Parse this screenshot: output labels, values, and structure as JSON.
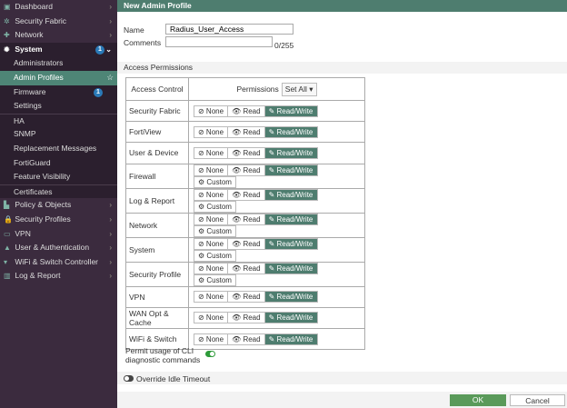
{
  "sidebar": {
    "top": [
      {
        "label": "Dashboard",
        "icon": "dashboard-icon"
      },
      {
        "label": "Security Fabric",
        "icon": "fabric-icon"
      },
      {
        "label": "Network",
        "icon": "network-icon"
      }
    ],
    "system": {
      "label": "System",
      "badge": "1"
    },
    "sub": [
      {
        "label": "Administrators"
      },
      {
        "label": "Admin Profiles",
        "active": true
      },
      {
        "label": "Firmware",
        "badge": "1"
      },
      {
        "label": "Settings"
      },
      {
        "label": "HA"
      },
      {
        "label": "SNMP"
      },
      {
        "label": "Replacement Messages"
      },
      {
        "label": "FortiGuard"
      },
      {
        "label": "Feature Visibility"
      },
      {
        "label": "Certificates"
      }
    ],
    "bottom": [
      {
        "label": "Policy & Objects"
      },
      {
        "label": "Security Profiles"
      },
      {
        "label": "VPN"
      },
      {
        "label": "User & Authentication"
      },
      {
        "label": "WiFi & Switch Controller"
      },
      {
        "label": "Log & Report"
      }
    ]
  },
  "form": {
    "title": "New Admin Profile",
    "name_label": "Name",
    "name_value": "Radius_User_Access",
    "comments_label": "Comments",
    "comments_count": "0/255",
    "section": "Access Permissions",
    "col_access": "Access Control",
    "col_perm": "Permissions",
    "set_all": "Set All ▾",
    "btn_none": "⊘ None",
    "btn_read": "👁 Read",
    "btn_rw": "✎ Read/Write",
    "btn_custom": "⚙ Custom",
    "rows": [
      {
        "name": "Security Fabric",
        "value": "Read/Write",
        "custom": false
      },
      {
        "name": "FortiView",
        "value": "Read/Write",
        "custom": false
      },
      {
        "name": "User & Device",
        "value": "Read/Write",
        "custom": false
      },
      {
        "name": "Firewall",
        "value": "Read/Write",
        "custom": true
      },
      {
        "name": "Log & Report",
        "value": "Read/Write",
        "custom": true
      },
      {
        "name": "Network",
        "value": "Read/Write",
        "custom": true
      },
      {
        "name": "System",
        "value": "Read/Write",
        "custom": true
      },
      {
        "name": "Security Profile",
        "value": "Read/Write",
        "custom": true
      },
      {
        "name": "VPN",
        "value": "Read/Write",
        "custom": false
      },
      {
        "name": "WAN Opt & Cache",
        "value": "Read/Write",
        "custom": false
      },
      {
        "name": "WiFi & Switch",
        "value": "Read/Write",
        "custom": false
      }
    ],
    "cli_label": "Permit usage of CLI diagnostic commands",
    "cli_enabled": true,
    "idle_label": "Override Idle Timeout",
    "idle_enabled": false,
    "ok": "OK",
    "cancel": "Cancel"
  },
  "colors": {
    "accent": "#4e7d6f",
    "sidebar": "#3b2b3e"
  }
}
